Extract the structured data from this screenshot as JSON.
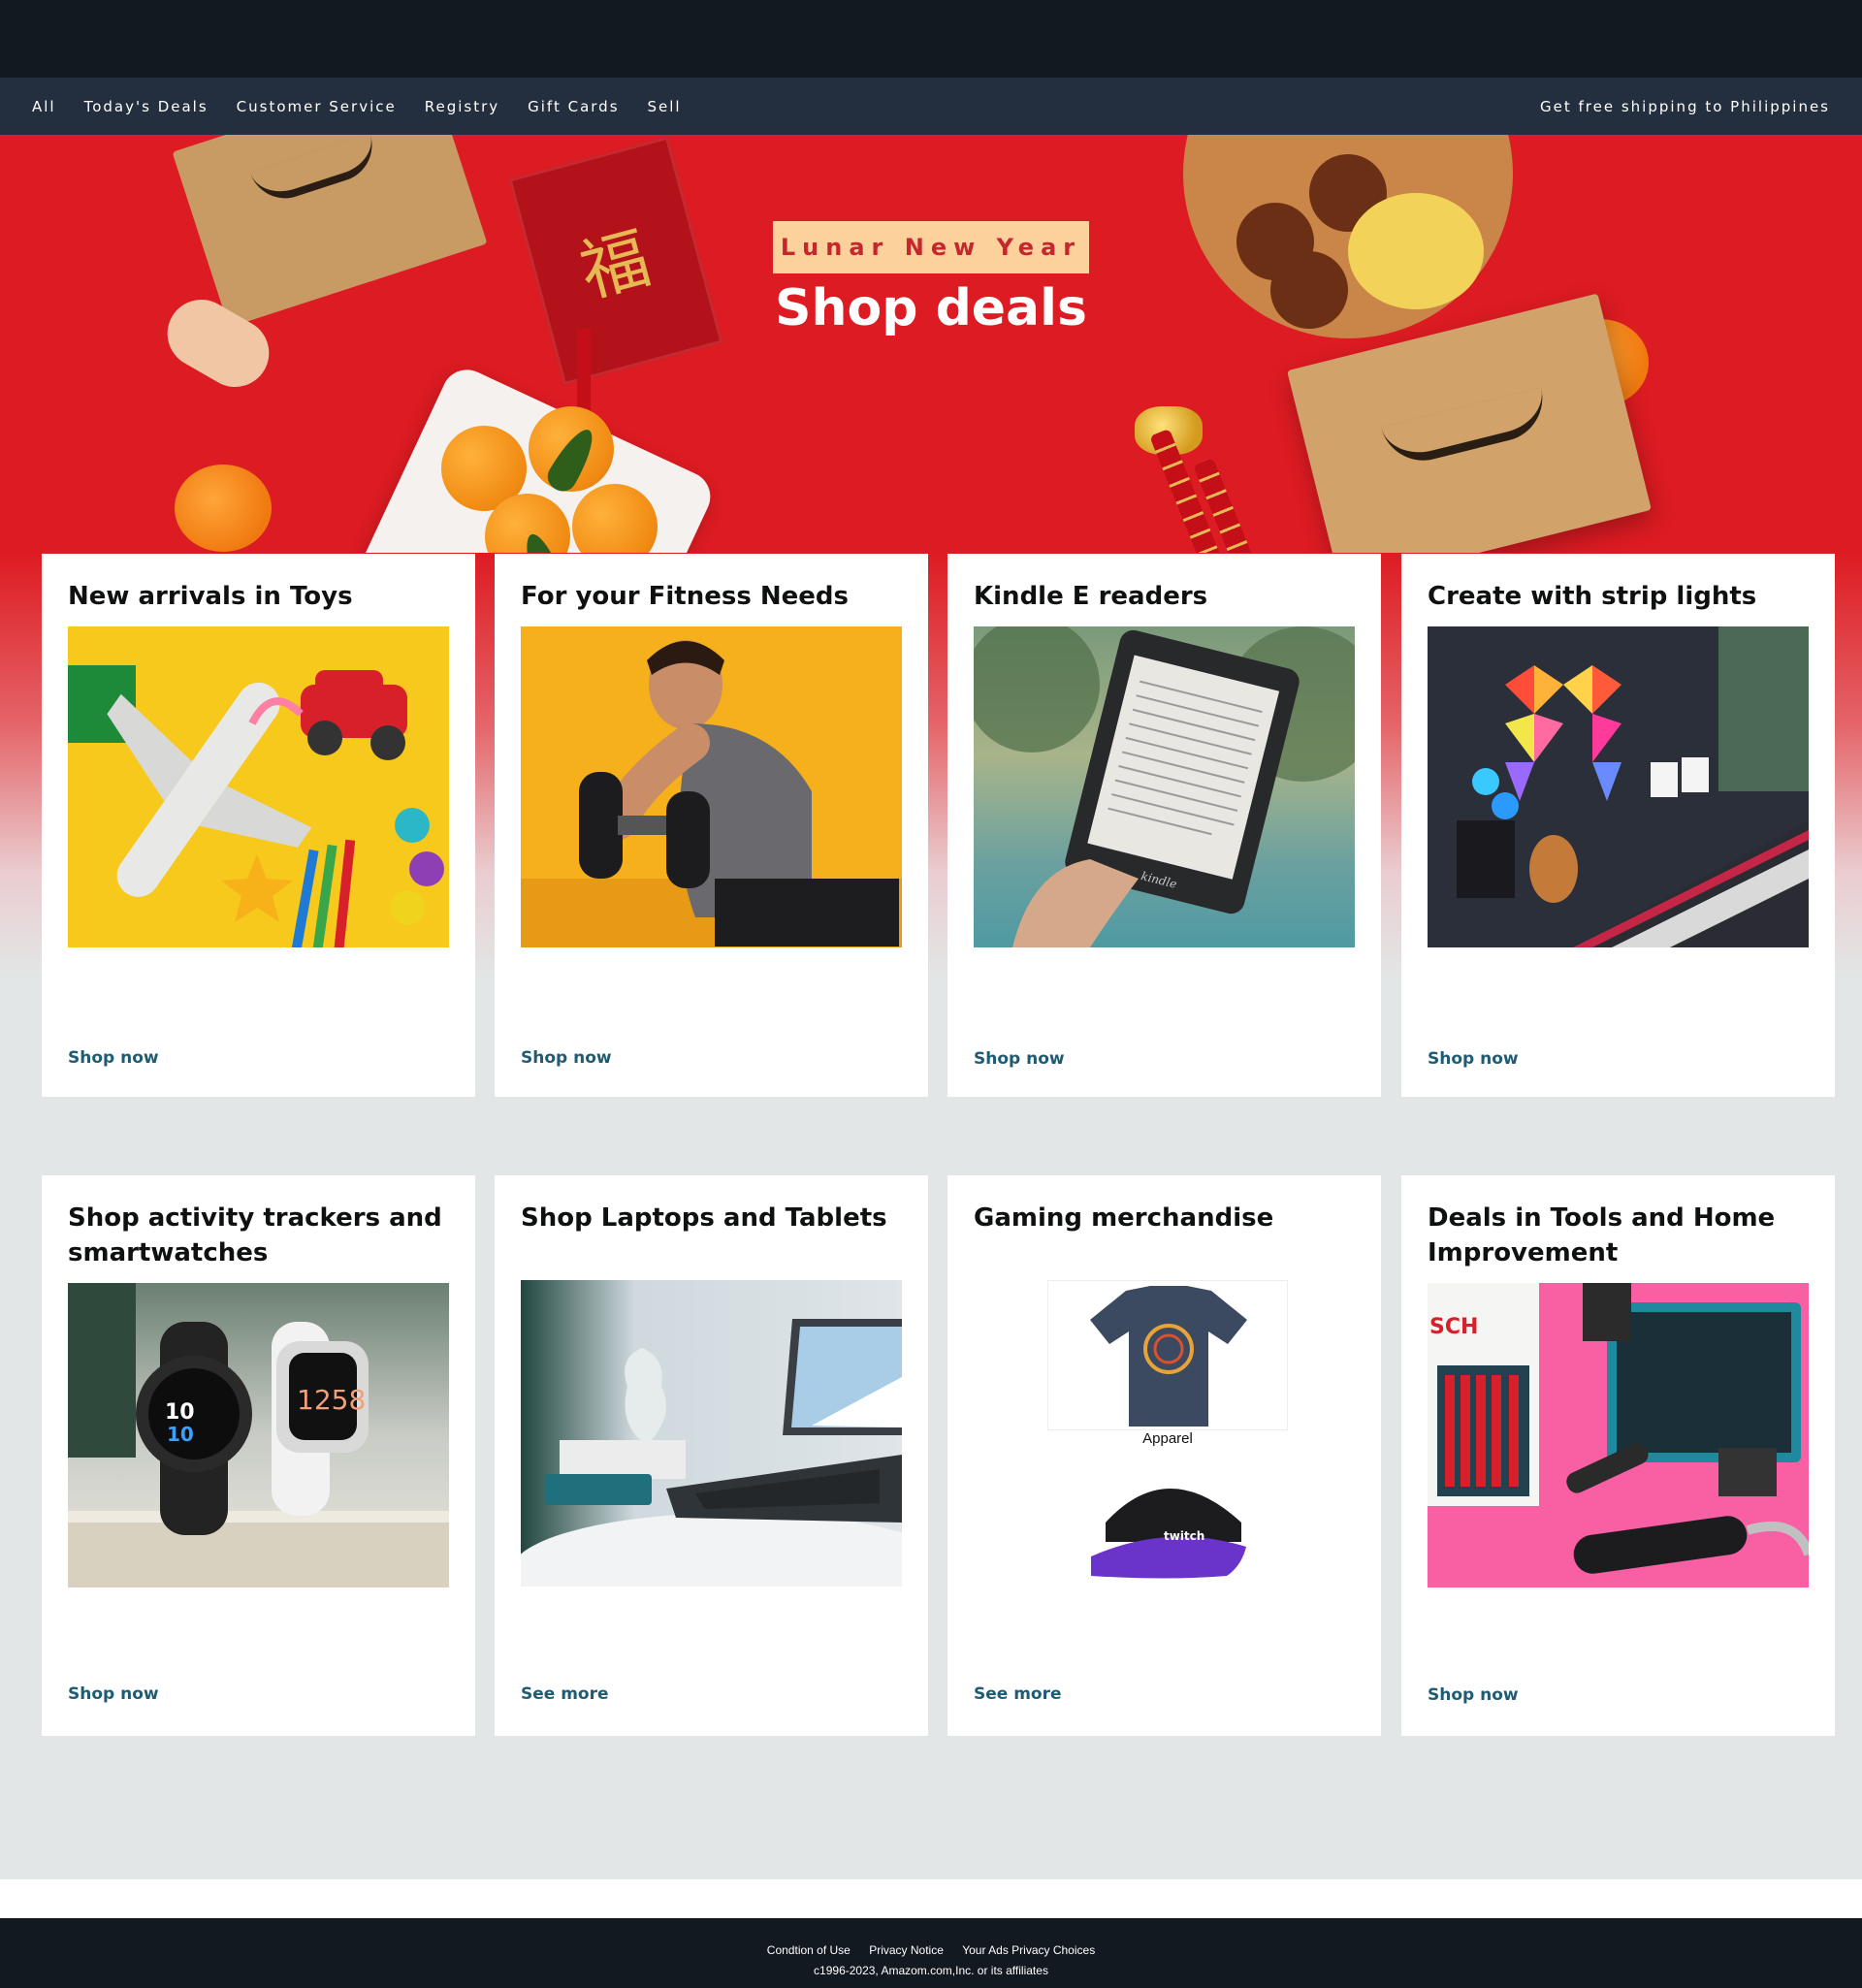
{
  "nav": {
    "items": [
      "All",
      "Today's Deals",
      "Customer Service",
      "Registry",
      "Gift Cards",
      "Sell"
    ],
    "shipping": "Get free shipping to Philippines"
  },
  "hero": {
    "badge": "Lunar New Year",
    "title": "Shop deals",
    "envelope_glyph": "福"
  },
  "cards": [
    {
      "title": "New arrivals in Toys",
      "link": "Shop now"
    },
    {
      "title": "For your Fitness Needs",
      "link": "Shop now"
    },
    {
      "title": "Kindle E readers",
      "link": "Shop now",
      "kindle_text": "kindle"
    },
    {
      "title": "Create with strip lights",
      "link": "Shop now"
    },
    {
      "title": "Shop activity trackers and smartwatches",
      "link": "Shop now",
      "watch1": "10",
      "watch2": "1258"
    },
    {
      "title": "Shop Laptops and Tablets",
      "link": "See more"
    },
    {
      "title": "Gaming merchandise",
      "link": "See more",
      "tile_label": "Apparel",
      "cap_text": "twitch"
    },
    {
      "title": "Deals in Tools and Home Improvement",
      "link": "Shop now",
      "brand_text": "SCH"
    }
  ],
  "footer": {
    "links": [
      "Condtion of Use",
      "Privacy Notice",
      "Your Ads Privacy Choices"
    ],
    "copyright": "c1996-2023, Amazom.com,Inc. or its affiliates"
  },
  "colors": {
    "topbar": "#131921",
    "navbar": "#232f3e",
    "hero_red": "#dd1b22",
    "badge_bg": "#fcd19c",
    "link": "#1f5c73",
    "page_bg": "#e3e6e6"
  }
}
